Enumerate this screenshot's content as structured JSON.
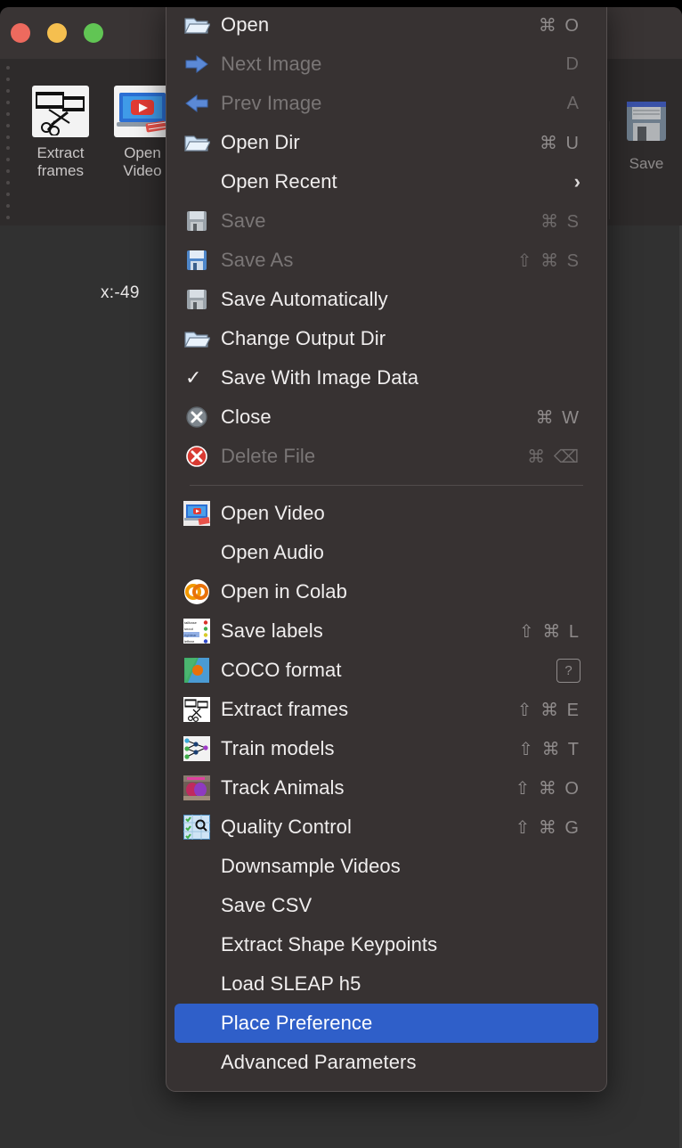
{
  "window": {
    "traffic_lights": [
      "close",
      "minimize",
      "zoom"
    ],
    "colors": {
      "close": "#ed6a5e",
      "minimize": "#f5bf4f",
      "zoom": "#61c554",
      "titlebar_bg": "#393434",
      "toolbar_bg": "#2e2b2b",
      "canvas_bg": "#313131",
      "menu_bg": "#373232",
      "menu_border": "#565050",
      "highlight": "#2f5fc9",
      "text": "#f0eeee",
      "text_disabled": "#7a7676",
      "accel_text": "#8f8b8b"
    }
  },
  "toolbar": {
    "items": [
      {
        "label": "Extract\nframes",
        "icon": "extract-frames-icon"
      },
      {
        "label": "Open\nVideo",
        "icon": "open-video-icon"
      },
      {
        "label": "Save",
        "icon": "save-floppy-icon"
      }
    ]
  },
  "canvas": {
    "coordinate_readout": "x:-49"
  },
  "menu": {
    "title": "File",
    "groups": [
      {
        "items": [
          {
            "label": "Open",
            "accel": "⌘ O",
            "icon": "open-folder-icon",
            "enabled": true,
            "checked": false,
            "submenu": false
          },
          {
            "label": "Next Image",
            "accel": "D",
            "icon": "arrow-right-icon",
            "enabled": false,
            "checked": false,
            "submenu": false
          },
          {
            "label": "Prev Image",
            "accel": "A",
            "icon": "arrow-left-icon",
            "enabled": false,
            "checked": false,
            "submenu": false
          },
          {
            "label": "Open Dir",
            "accel": "⌘ U",
            "icon": "open-folder-icon",
            "enabled": true,
            "checked": false,
            "submenu": false
          },
          {
            "label": "Open Recent",
            "accel": "",
            "icon": "none",
            "enabled": true,
            "checked": false,
            "submenu": true
          },
          {
            "label": "Save",
            "accel": "⌘ S",
            "icon": "floppy-grey-icon",
            "enabled": false,
            "checked": false,
            "submenu": false
          },
          {
            "label": "Save As",
            "accel": "⇧ ⌘ S",
            "icon": "floppy-blue-icon",
            "enabled": false,
            "checked": false,
            "submenu": false
          },
          {
            "label": "Save Automatically",
            "accel": "",
            "icon": "floppy-grey-icon",
            "enabled": true,
            "checked": false,
            "submenu": false
          },
          {
            "label": "Change Output Dir",
            "accel": "",
            "icon": "open-folder-icon",
            "enabled": true,
            "checked": false,
            "submenu": false
          },
          {
            "label": "Save With Image Data",
            "accel": "",
            "icon": "none",
            "enabled": true,
            "checked": true,
            "submenu": false
          },
          {
            "label": "Close",
            "accel": "⌘ W",
            "icon": "close-grey-x-icon",
            "enabled": true,
            "checked": false,
            "submenu": false
          },
          {
            "label": "Delete File",
            "accel": "⌘ ⌫",
            "icon": "delete-red-x-icon",
            "enabled": false,
            "checked": false,
            "submenu": false
          }
        ]
      },
      {
        "items": [
          {
            "label": "Open Video",
            "accel": "",
            "icon": "open-video-icon",
            "enabled": true,
            "checked": false,
            "submenu": false
          },
          {
            "label": "Open Audio",
            "accel": "",
            "icon": "none",
            "enabled": true,
            "checked": false,
            "submenu": false
          },
          {
            "label": "Open in Colab",
            "accel": "",
            "icon": "colab-icon",
            "enabled": true,
            "checked": false,
            "submenu": false
          },
          {
            "label": "Save labels",
            "accel": "⇧ ⌘ L",
            "icon": "save-labels-icon",
            "enabled": true,
            "checked": false,
            "submenu": false
          },
          {
            "label": "COCO format",
            "accel": "?",
            "icon": "coco-icon",
            "enabled": true,
            "checked": false,
            "submenu": false,
            "accel_boxed": true
          },
          {
            "label": "Extract frames",
            "accel": "⇧ ⌘ E",
            "icon": "extract-frames-icon",
            "enabled": true,
            "checked": false,
            "submenu": false
          },
          {
            "label": "Train models",
            "accel": "⇧ ⌘ T",
            "icon": "train-models-icon",
            "enabled": true,
            "checked": false,
            "submenu": false
          },
          {
            "label": "Track Animals",
            "accel": "⇧ ⌘ O",
            "icon": "track-animals-icon",
            "enabled": true,
            "checked": false,
            "submenu": false
          },
          {
            "label": "Quality Control",
            "accel": "⇧ ⌘ G",
            "icon": "quality-control-icon",
            "enabled": true,
            "checked": false,
            "submenu": false
          },
          {
            "label": "Downsample Videos",
            "accel": "",
            "icon": "none",
            "enabled": true,
            "checked": false,
            "submenu": false
          },
          {
            "label": "Save CSV",
            "accel": "",
            "icon": "none",
            "enabled": true,
            "checked": false,
            "submenu": false
          },
          {
            "label": "Extract Shape Keypoints",
            "accel": "",
            "icon": "none",
            "enabled": true,
            "checked": false,
            "submenu": false
          },
          {
            "label": "Load SLEAP h5",
            "accel": "",
            "icon": "none",
            "enabled": true,
            "checked": false,
            "submenu": false
          },
          {
            "label": "Place Preference",
            "accel": "",
            "icon": "none",
            "enabled": true,
            "checked": false,
            "submenu": false,
            "selected": true
          },
          {
            "label": "Advanced Parameters",
            "accel": "",
            "icon": "none",
            "enabled": true,
            "checked": false,
            "submenu": false
          }
        ]
      }
    ],
    "checkmark_glyph": "✓",
    "submenu_glyph": "›"
  }
}
